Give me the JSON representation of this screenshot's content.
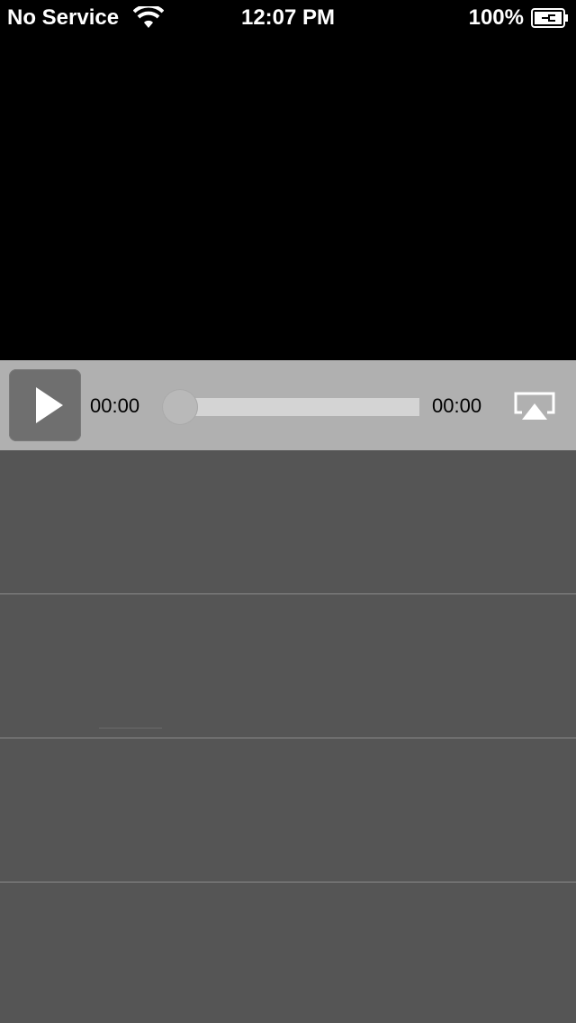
{
  "status_bar": {
    "carrier": "No Service",
    "time": "12:07 PM",
    "battery": "100%",
    "wifi_icon": "wifi-icon",
    "battery_icon": "battery-charging-icon"
  },
  "player": {
    "play_icon": "play-icon",
    "current_time": "00:00",
    "total_time": "00:00",
    "progress": 0,
    "airplay_icon": "airplay-icon"
  },
  "list": {
    "rows": [
      {},
      {},
      {},
      {}
    ]
  },
  "colors": {
    "controls_bg": "#b0b0b0",
    "list_bg": "#555555",
    "video_bg": "#000000"
  }
}
